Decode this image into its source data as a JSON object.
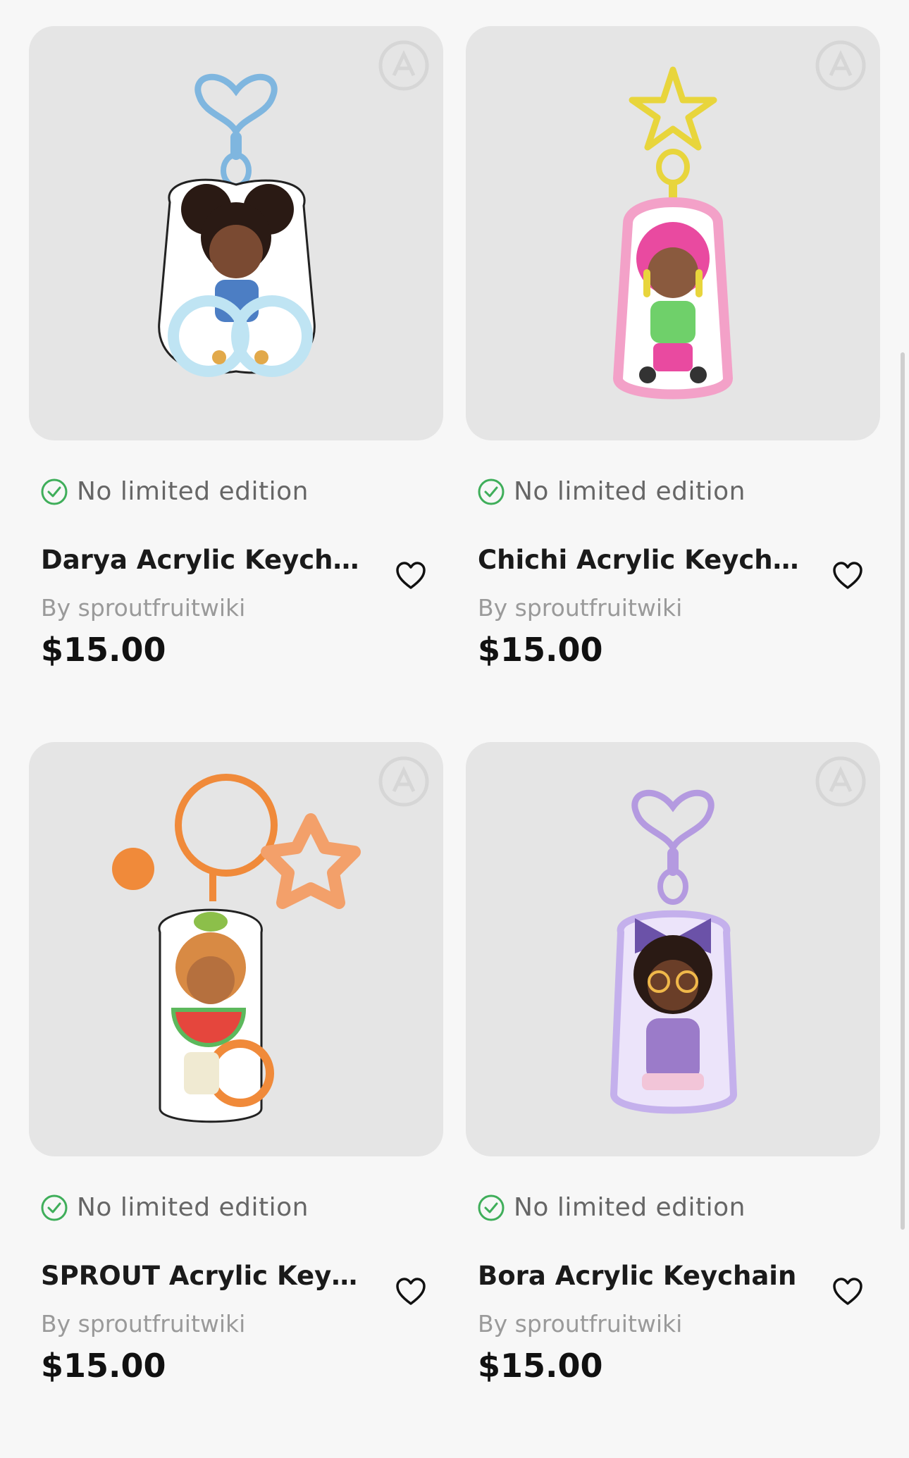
{
  "products": [
    {
      "limited_label": "No limited edition",
      "title": "Darya Acrylic Keychain",
      "seller": "By sproutfruitwiki",
      "price": "$15.00",
      "clasp_color": "#7fb6df",
      "accent_color": "#bfe4f3"
    },
    {
      "limited_label": "No limited edition",
      "title": "Chichi Acrylic Keychain",
      "seller": "By sproutfruitwiki",
      "price": "$15.00",
      "clasp_color": "#e8d53c",
      "accent_color": "#f3a1c8"
    },
    {
      "limited_label": "No limited edition",
      "title": "SPROUT Acrylic Keych...",
      "seller": "By sproutfruitwiki",
      "price": "$15.00",
      "clasp_color": "#f08a3a",
      "accent_color": "#e5463d"
    },
    {
      "limited_label": "No limited edition",
      "title": "Bora Acrylic Keychain",
      "seller": "By sproutfruitwiki",
      "price": "$15.00",
      "clasp_color": "#b49ae0",
      "accent_color": "#9b7bc9"
    }
  ],
  "colors": {
    "check_green": "#3fae5a",
    "card_bg": "#e5e5e5",
    "page_bg": "#f7f7f7"
  },
  "icons": {
    "check": "check-circle-icon",
    "heart": "heart-outline-icon",
    "watermark": "brand-watermark-icon"
  }
}
